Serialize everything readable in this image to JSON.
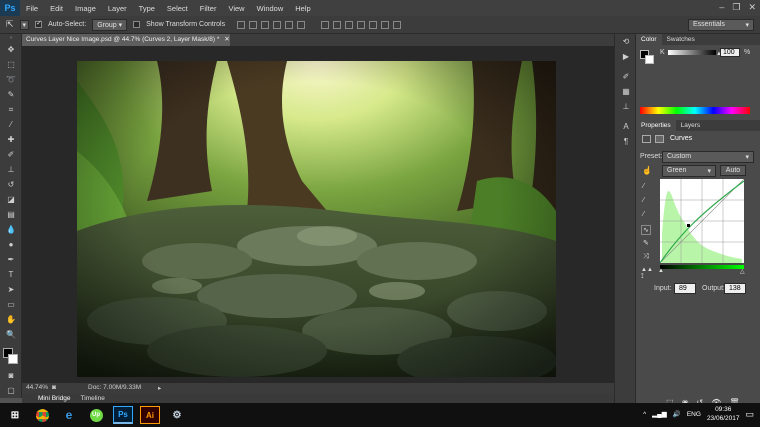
{
  "menubar": {
    "logo": "Ps",
    "items": [
      "File",
      "Edit",
      "Image",
      "Layer",
      "Type",
      "Select",
      "Filter",
      "View",
      "Window",
      "Help"
    ]
  },
  "options": {
    "auto_select_label": "Auto-Select:",
    "auto_select_value": "Group",
    "transform_label": "Show Transform Controls",
    "workspace": "Essentials"
  },
  "document": {
    "tab_title": "Curves Layer Nice Image.psd @ 44.7% (Curves 2, Layer Mask/8) *",
    "zoom": "44.74%",
    "doc_size": "Doc: 7.00M/9.33M"
  },
  "bottom_tabs": [
    "Mini Bridge",
    "Timeline"
  ],
  "color_panel": {
    "tabs": [
      "Color",
      "Swatches"
    ],
    "channel": "K",
    "value": "100",
    "unit": "%"
  },
  "properties_panel": {
    "tabs": [
      "Properties",
      "Layers"
    ],
    "title": "Curves",
    "preset_label": "Preset:",
    "preset_value": "Custom",
    "channel_value": "Green",
    "auto_label": "Auto",
    "input_label": "Input:",
    "input_value": "89",
    "output_label": "Output:",
    "output_value": "138"
  },
  "taskbar": {
    "lang": "ENG",
    "time": "09:36",
    "date": "23/06/2017",
    "apps": [
      "start",
      "chrome",
      "edge",
      "upwork",
      "photoshop",
      "illustrator",
      "steam"
    ]
  },
  "colors": {
    "ps_blue": "#31a8ff",
    "curve_fill": "#b8f5a8",
    "curve_line": "#2ea84a"
  }
}
